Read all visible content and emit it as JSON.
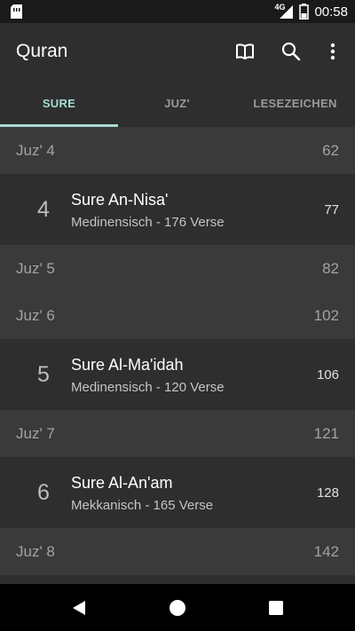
{
  "status_bar": {
    "network": "4G",
    "time": "00:58",
    "icons": [
      "sim-card-icon",
      "signal-icon",
      "battery-icon"
    ]
  },
  "app_bar": {
    "title": "Quran",
    "actions": [
      "open-book-icon",
      "search-icon",
      "more-vert-icon"
    ]
  },
  "tabs": [
    {
      "label": "SURE",
      "active": true
    },
    {
      "label": "JUZ'",
      "active": false
    },
    {
      "label": "LESEZEICHEN",
      "active": false
    }
  ],
  "list": {
    "juz4": {
      "label": "Juz' 4",
      "page": "62"
    },
    "sura4": {
      "number": "4",
      "name": "Sure An-Nisa'",
      "meta": "Medinensisch - 176 Verse",
      "page": "77"
    },
    "juz5": {
      "label": "Juz' 5",
      "page": "82"
    },
    "juz6": {
      "label": "Juz' 6",
      "page": "102"
    },
    "sura5": {
      "number": "5",
      "name": "Sure Al-Ma'idah",
      "meta": "Medinensisch - 120 Verse",
      "page": "106"
    },
    "juz7": {
      "label": "Juz' 7",
      "page": "121"
    },
    "sura6": {
      "number": "6",
      "name": "Sure Al-An'am",
      "meta": "Mekkanisch - 165 Verse",
      "page": "128"
    },
    "juz8": {
      "label": "Juz' 8",
      "page": "142"
    }
  },
  "nav_bar": {
    "icons": [
      "back-icon",
      "home-icon",
      "recents-icon"
    ]
  },
  "colors": {
    "accent": "#a6dcd3",
    "app_bar": "#2e2e2e",
    "juz_row": "#3a3a3a",
    "sura_row": "#2e2e2e"
  }
}
